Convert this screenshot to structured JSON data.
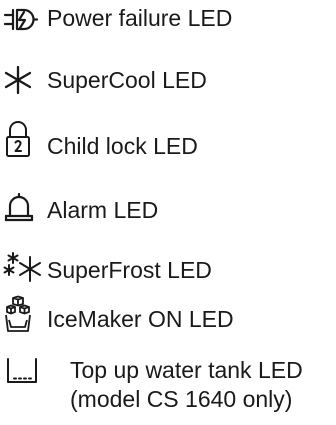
{
  "legend": {
    "items": [
      {
        "icon": "power-failure-icon",
        "label": "Power failure LED"
      },
      {
        "icon": "supercool-icon",
        "label": "SuperCool LED"
      },
      {
        "icon": "child-lock-icon",
        "label": "Child lock LED"
      },
      {
        "icon": "alarm-bell-icon",
        "label": "Alarm LED"
      },
      {
        "icon": "superfrost-icon",
        "label": "SuperFrost LED"
      },
      {
        "icon": "icemaker-icon",
        "label": "IceMaker ON LED"
      },
      {
        "icon": "water-tank-icon",
        "label": "Top up water tank LED",
        "label_line2": "(model CS 1640 only)"
      }
    ]
  },
  "colors": {
    "ink": "#1a1a1a",
    "background": "#ffffff"
  }
}
